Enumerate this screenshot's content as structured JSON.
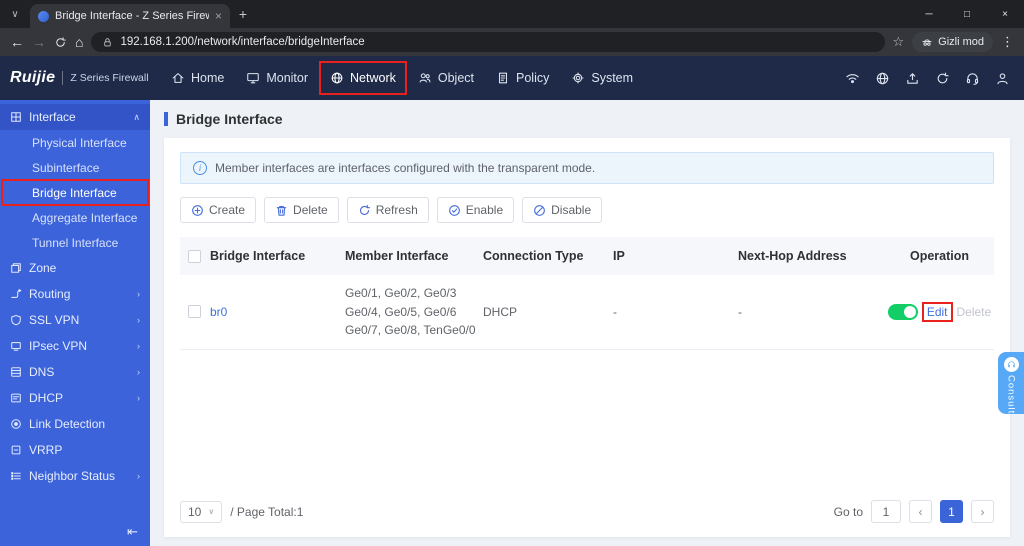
{
  "browser": {
    "tab_title": "Bridge Interface - Z Series Firew",
    "url": "192.168.1.200/network/interface/bridgeInterface",
    "incognito_label": "Gizli mod"
  },
  "glyphs": {
    "tab_search": "∨",
    "tab_close": "×",
    "new_tab": "+",
    "win_min": "─",
    "win_max": "□",
    "win_close": "×",
    "back": "←",
    "forward": "→",
    "home": "⌂",
    "star": "☆",
    "menu": "⋮",
    "chevron_up": "∧",
    "chevron_right": "›",
    "page_prev": "‹",
    "page_next": "›",
    "select_caret": "∨",
    "collapse": "⇤"
  },
  "header": {
    "brand": "Ruijie",
    "product": "Z Series Firewall",
    "nav": [
      {
        "label": "Home"
      },
      {
        "label": "Monitor"
      },
      {
        "label": "Network"
      },
      {
        "label": "Object"
      },
      {
        "label": "Policy"
      },
      {
        "label": "System"
      }
    ]
  },
  "sidebar": {
    "items": [
      {
        "label": "Interface"
      },
      {
        "label": "Zone"
      },
      {
        "label": "Routing"
      },
      {
        "label": "SSL VPN"
      },
      {
        "label": "IPsec VPN"
      },
      {
        "label": "DNS"
      },
      {
        "label": "DHCP"
      },
      {
        "label": "Link Detection"
      },
      {
        "label": "VRRP"
      },
      {
        "label": "Neighbor Status"
      }
    ],
    "interface_children": [
      {
        "label": "Physical Interface"
      },
      {
        "label": "Subinterface"
      },
      {
        "label": "Bridge Interface"
      },
      {
        "label": "Aggregate Interface"
      },
      {
        "label": "Tunnel Interface"
      }
    ]
  },
  "main": {
    "page_title": "Bridge Interface",
    "banner_text": "Member interfaces are interfaces configured with the transparent mode.",
    "toolbar": [
      {
        "label": "Create"
      },
      {
        "label": "Delete"
      },
      {
        "label": "Refresh"
      },
      {
        "label": "Enable"
      },
      {
        "label": "Disable"
      }
    ],
    "table": {
      "headers": [
        "Bridge Interface",
        "Member Interface",
        "Connection Type",
        "IP",
        "Next-Hop Address",
        "Operation"
      ],
      "row": {
        "name": "br0",
        "member_lines": [
          "Ge0/1, Ge0/2, Ge0/3",
          "Ge0/4, Ge0/5, Ge0/6",
          "Ge0/7, Ge0/8, TenGe0/0"
        ],
        "connection_type": "DHCP",
        "ip": "-",
        "next_hop": "-",
        "edit_label": "Edit",
        "delete_label": "Delete"
      }
    },
    "pagination": {
      "page_size": "10",
      "total_label": "/ Page Total:1",
      "goto_label": "Go to",
      "goto_value": "1",
      "page": "1"
    }
  },
  "consult_label": "Consult",
  "colors": {
    "accent_blue": "#3a64d8",
    "link_blue": "#3f6fe0",
    "toggle_green": "#13ce66",
    "annotation_red": "#e8211d"
  }
}
